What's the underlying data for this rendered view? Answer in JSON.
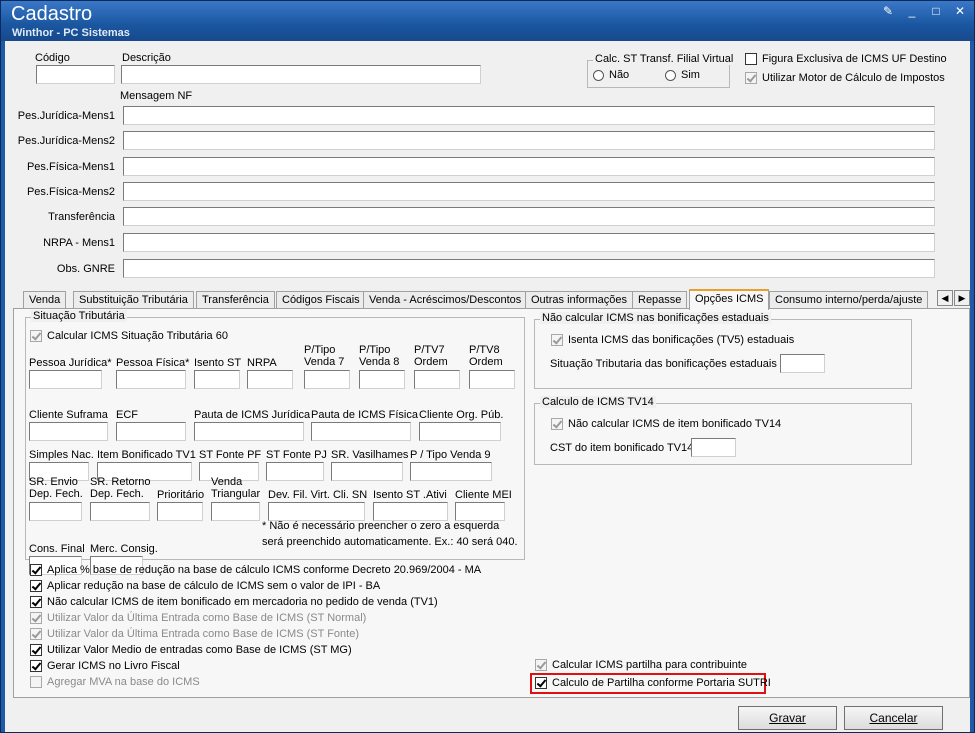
{
  "window": {
    "title": "Cadastro",
    "subtitle": "Winthor - PC Sistemas"
  },
  "top": {
    "codigo_label": "Código",
    "descricao_label": "Descrição",
    "calc_st_group": "Calc. ST Transf. Filial Virtual",
    "radio_nao": "Não",
    "radio_sim": "Sim",
    "figura_exclusiva": "Figura Exclusiva de ICMS UF Destino",
    "utilizar_motor": "Utilizar Motor de Cálculo de Impostos",
    "mensagem_nf": "Mensagem NF"
  },
  "mensagens": [
    "Pes.Jurídica-Mens1",
    "Pes.Jurídica-Mens2",
    "Pes.Física-Mens1",
    "Pes.Física-Mens2",
    "Transferência",
    "NRPA - Mens1",
    "Obs. GNRE"
  ],
  "tabs": [
    "Venda",
    "Substituição Tributária",
    "Transferência",
    "Códigos Fiscais",
    "Venda - Acréscimos/Descontos",
    "Outras informações",
    "Repasse",
    "Opções ICMS",
    "Consumo interno/perda/ajuste"
  ],
  "situacao": {
    "group": "Situação Tributária",
    "calc_check": "Calcular ICMS Situação Tributária 60",
    "row1": [
      "Pessoa Jurídica*",
      "Pessoa Física*",
      "Isento ST",
      "NRPA",
      "P/Tipo\nVenda 7",
      "P/Tipo\nVenda 8",
      "P/TV7\nOrdem",
      "P/TV8\nOrdem"
    ],
    "row2": [
      "Cliente Suframa",
      "ECF",
      "Pauta de ICMS Jurídica",
      "Pauta de ICMS Física",
      "Cliente Org. Púb."
    ],
    "row3": [
      "Simples Nac.",
      "Item Bonificado TV1",
      "ST Fonte PF",
      "ST Fonte PJ",
      "SR. Vasilhames",
      "P / Tipo Venda 9"
    ],
    "row4": [
      "SR. Envio\nDep. Fech.",
      "SR. Retorno\nDep. Fech.",
      "Prioritário",
      "Venda\nTriangular",
      "Dev. Fil. Virt. Cli. SN",
      "Isento ST .Ativi",
      "Cliente MEI"
    ],
    "row5": [
      "Cons. Final",
      "Merc. Consig."
    ],
    "note1": "* Não é necessário preencher o zero a esquerda",
    "note2": "será preenchido automaticamente.  Ex.: 40 será 040."
  },
  "bonif": {
    "group": "Não calcular ICMS nas bonificações estaduais",
    "isenta": "Isenta ICMS das bonificações (TV5) estaduais",
    "situacao": "Situação Tributaria das  bonificações estaduais"
  },
  "tv14": {
    "group": "Calculo de ICMS TV14",
    "nao_calcular": "Não calcular ICMS de item bonificado TV14",
    "cst": "CST do item bonificado TV14"
  },
  "options": [
    {
      "label": "Aplica % base de redução na base de cálculo ICMS conforme Decreto 20.969/2004 - MA",
      "checked": true,
      "disabled": false
    },
    {
      "label": "Aplicar redução na base de cálculo de ICMS sem o valor de IPI - BA",
      "checked": true,
      "disabled": false
    },
    {
      "label": "Não calcular ICMS de item bonificado em mercadoria no pedido de venda (TV1)",
      "checked": true,
      "disabled": false
    },
    {
      "label": "Utilizar Valor da Última Entrada como Base de ICMS (ST Normal)",
      "checked": true,
      "disabled": true
    },
    {
      "label": "Utilizar Valor da Última Entrada como Base de ICMS (ST Fonte)",
      "checked": true,
      "disabled": true
    },
    {
      "label": "Utilizar Valor Medio de entradas como Base de ICMS (ST MG)",
      "checked": true,
      "disabled": false
    },
    {
      "label": "Gerar ICMS no Livro Fiscal",
      "checked": true,
      "disabled": false
    },
    {
      "label": "Agregar MVA na base do ICMS",
      "checked": false,
      "disabled": true
    }
  ],
  "partilha": {
    "calcular": "Calcular ICMS partilha para contribuinte",
    "calculo": "Calculo de Partilha conforme Portaria SUTRI"
  },
  "buttons": {
    "gravar": "Gravar",
    "cancelar": "Cancelar"
  },
  "colors": {
    "highlight": "#e01010",
    "active_tab": "#e8a02a",
    "title_bar": "#1a56a0"
  }
}
